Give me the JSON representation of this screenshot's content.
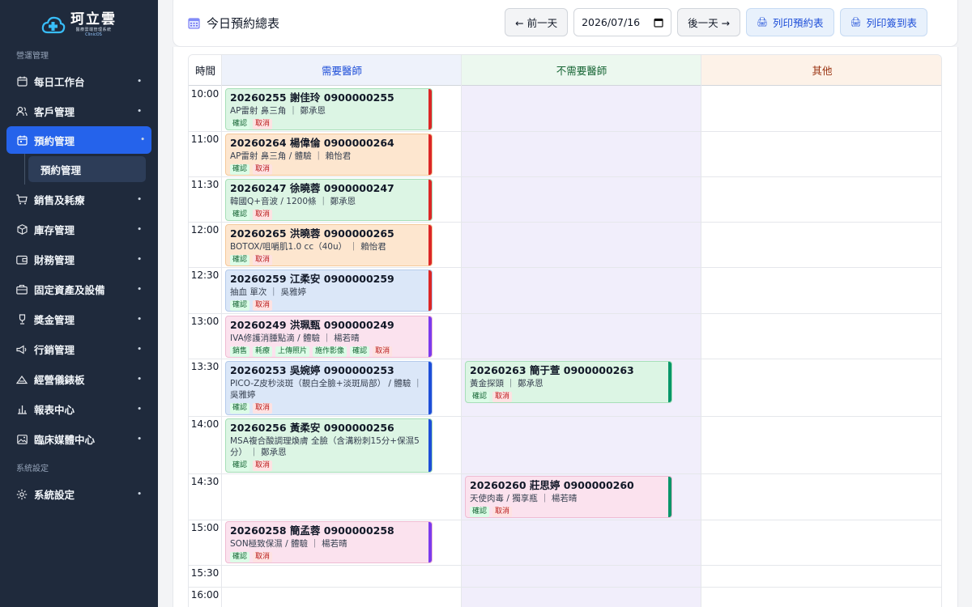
{
  "app": {
    "name": "珂立雲",
    "subtitle": "醫療雲端管理系統",
    "tagline": "ClinicOS"
  },
  "sidebar": {
    "section_ops": "營運管理",
    "section_sys": "系統設定",
    "items": [
      {
        "label": "每日工作台",
        "icon": "calendar-icon"
      },
      {
        "label": "客戶管理",
        "icon": "users-icon"
      },
      {
        "label": "預約管理",
        "icon": "calendar-check-icon"
      },
      {
        "label": "銷售及耗療",
        "icon": "cart-icon"
      },
      {
        "label": "庫存管理",
        "icon": "box-icon"
      },
      {
        "label": "財務管理",
        "icon": "wallet-icon"
      },
      {
        "label": "固定資產及設備",
        "icon": "briefcase-icon"
      },
      {
        "label": "獎金管理",
        "icon": "trophy-icon"
      },
      {
        "label": "行銷管理",
        "icon": "megaphone-icon"
      },
      {
        "label": "經營儀錶板",
        "icon": "dashboard-icon"
      },
      {
        "label": "報表中心",
        "icon": "bar-chart-icon"
      },
      {
        "label": "臨床媒體中心",
        "icon": "image-icon"
      },
      {
        "label": "系統設定",
        "icon": "gear-icon"
      }
    ],
    "sub_active": "預約管理"
  },
  "header": {
    "title": "今日預約總表",
    "prev": "← 前一天",
    "date": "2026/07/16",
    "next": "後一天 →",
    "print_schedule": "列印預約表",
    "print_signin": "列印簽到表"
  },
  "grid": {
    "col_time": "時間",
    "col_doctor": "需要醫師",
    "col_nodoctor": "不需要醫師",
    "col_other": "其他",
    "times": [
      "10:00",
      "11:00",
      "11:30",
      "12:00",
      "12:30",
      "13:00",
      "13:30",
      "14:00",
      "14:30",
      "15:00",
      "15:30",
      "16:00"
    ]
  },
  "appointments": [
    {
      "title": "20260255 謝佳玲 0900000255",
      "detail": "AP雷射 鼻三角 ｜ 鄭承恩",
      "actions": [
        "確認",
        "取消"
      ]
    },
    {
      "title": "20260264 楊偉倫 0900000264",
      "detail": "AP雷射 鼻三角 / 體驗 ｜ 賴怡君",
      "actions": [
        "確認",
        "取消"
      ]
    },
    {
      "title": "20260247 徐曉蓉 0900000247",
      "detail": "韓國Q+音波 / 1200條 ｜ 鄭承恩",
      "actions": [
        "確認",
        "取消"
      ]
    },
    {
      "title": "20260265 洪曉蓉 0900000265",
      "detail": "BOTOX/咀嚼肌1.0 cc（40u） ｜ 賴怡君",
      "actions": [
        "確認",
        "取消"
      ]
    },
    {
      "title": "20260259 江柔安 0900000259",
      "detail": "抽血 單次 ｜ 吳雅婷",
      "actions": [
        "確認",
        "取消"
      ]
    },
    {
      "title": "20260249 洪珮甄 0900000249",
      "detail": "IVA修護消腫點滴 / 體驗 ｜ 楊若晴",
      "actions": [
        "銷售",
        "耗療",
        "上傳照片",
        "施作影像",
        "確認",
        "取消"
      ]
    },
    {
      "title": "20260253 吳婉婷 0900000253",
      "detail": "PICO-Z皮秒淡斑（靚白全臉+淡斑局部） / 體驗 ｜ 吳雅婷",
      "actions": [
        "確認",
        "取消"
      ]
    },
    {
      "title": "20260256 黃柔安 0900000256",
      "detail": "MSA複合酸調理煥膚 全臉（含溝粉刺15分+保濕5分） ｜ 鄭承恩",
      "actions": [
        "確認",
        "取消"
      ]
    },
    {
      "title": "20260258 簡孟蓉 0900000258",
      "detail": "SON極致保濕 / 體驗 ｜ 楊若晴",
      "actions": [
        "確認",
        "取消"
      ]
    },
    {
      "title": "20260263 簡于萱 0900000263",
      "detail": "黃金探頭 ｜ 鄭承恩",
      "actions": [
        "確認",
        "取消"
      ]
    },
    {
      "title": "20260260 莊思婷 0900000260",
      "detail": "天使肉毒 / 獨享瓶 ｜ 楊若晴",
      "actions": [
        "確認",
        "取消"
      ]
    }
  ],
  "colors": {
    "sidebar": "#1f2a3c",
    "accent": "#2563eb",
    "red_bar": "#dc2626",
    "purple_bar": "#7c3aed",
    "blue_bar": "#1d4ed8",
    "teal_bar": "#059669"
  }
}
